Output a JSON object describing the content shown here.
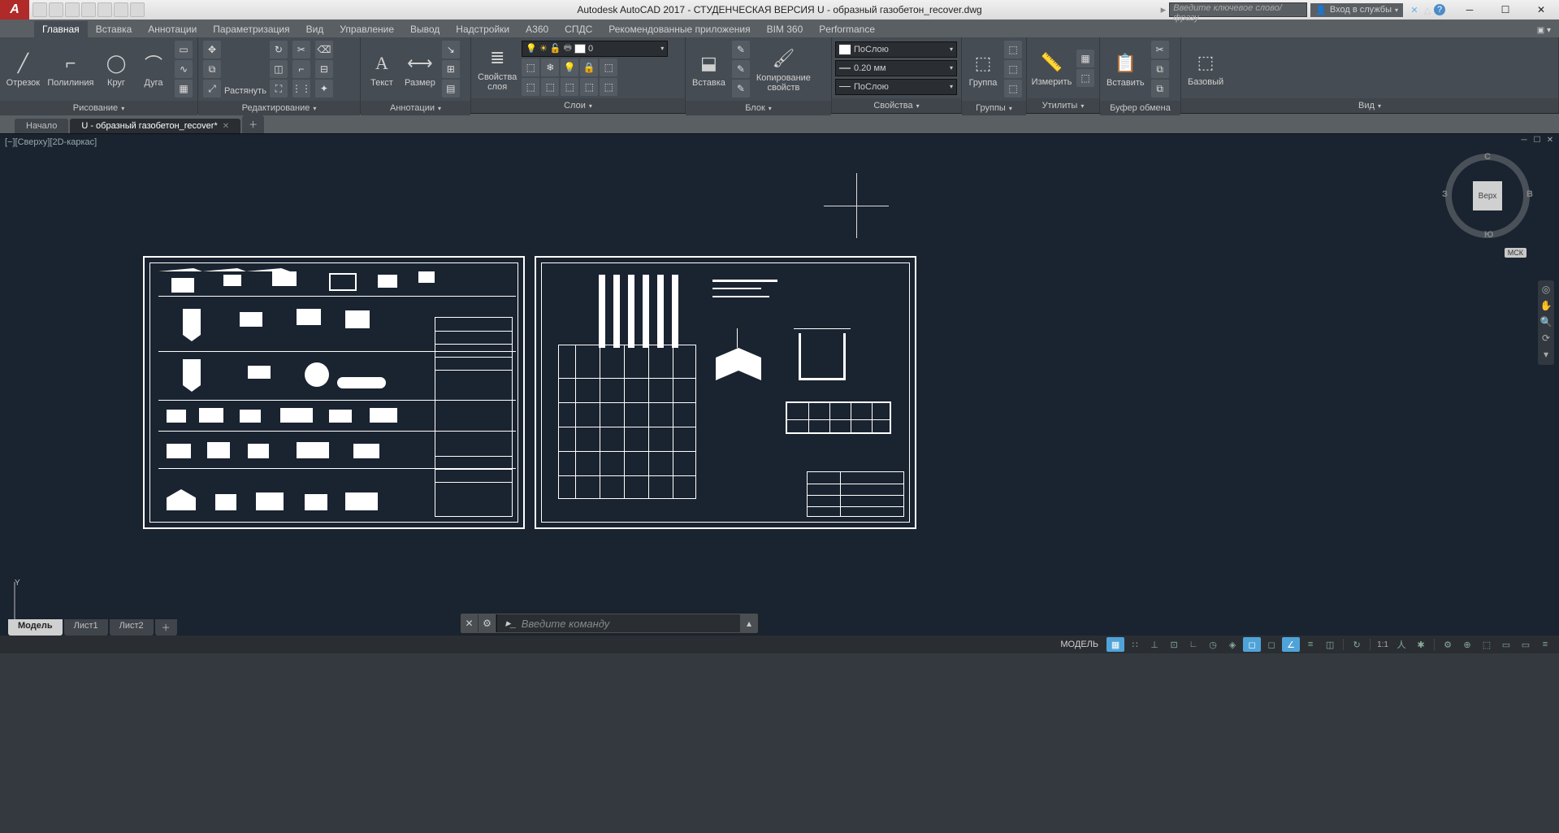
{
  "title": "Autodesk AutoCAD 2017 - СТУДЕНЧЕСКАЯ ВЕРСИЯ    U - образный газобетон_recover.dwg",
  "search_placeholder": "Введите ключевое слово/фразу",
  "signin_label": "Вход в службы",
  "ribbon_tabs": [
    "Главная",
    "Вставка",
    "Аннотации",
    "Параметризация",
    "Вид",
    "Управление",
    "Вывод",
    "Надстройки",
    "A360",
    "СПДС",
    "Рекомендованные приложения",
    "BIM 360",
    "Performance"
  ],
  "panels": {
    "draw": {
      "title": "Рисование",
      "line": "Отрезок",
      "polyline": "Полилиния",
      "circle": "Круг",
      "arc": "Дуга"
    },
    "modify": {
      "title": "Редактирование",
      "stretch": "Растянуть"
    },
    "annotate": {
      "title": "Аннотации",
      "text": "Текст",
      "dim": "Размер"
    },
    "layers": {
      "title": "Слои",
      "props": "Свойства\nслоя",
      "layer0": "0"
    },
    "block": {
      "title": "Блок",
      "insert": "Вставка",
      "matchp": "Копирование\nсвойств"
    },
    "properties": {
      "title": "Свойства",
      "bylayer": "ПоСлою",
      "lw": "0.20 мм"
    },
    "groups": {
      "title": "Группы",
      "group": "Группа"
    },
    "utilities": {
      "title": "Утилиты",
      "measure": "Измерить"
    },
    "clipboard": {
      "title": "Буфер обмена",
      "paste": "Вставить"
    },
    "view": {
      "title": "Вид",
      "base": "Базовый"
    }
  },
  "file_tabs": {
    "start": "Начало",
    "doc": "U - образный газобетон_recover*"
  },
  "vp_label": "[−][Сверху][2D-каркас]",
  "viewcube": {
    "top": "Верх",
    "n": "С",
    "s": "Ю",
    "e": "В",
    "w": "З",
    "wcs": "МСК"
  },
  "cmd_prompt": "Введите  команду",
  "layout_tabs": {
    "model": "Модель",
    "l1": "Лист1",
    "l2": "Лист2"
  },
  "status": {
    "model": "МОДЕЛЬ",
    "scale": "1:1"
  }
}
